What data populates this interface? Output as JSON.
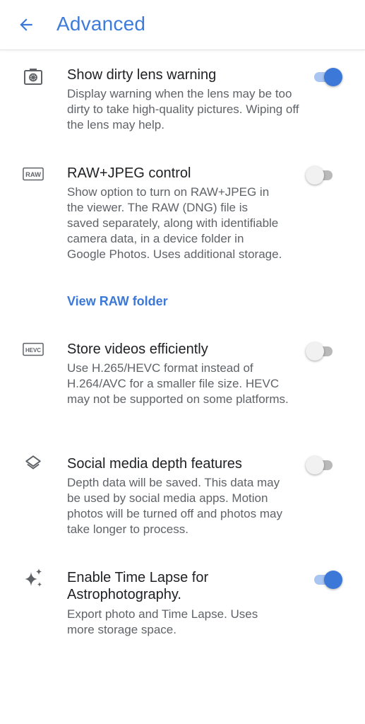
{
  "header": {
    "title": "Advanced"
  },
  "colors": {
    "accent": "#3b78d8",
    "title_text": "#202124",
    "secondary_text": "#5f6368",
    "toggle_off_track": "#b9b9b9"
  },
  "settings": [
    {
      "icon": "dirty-lens-icon",
      "title": "Show dirty lens warning",
      "description": "Display warning when the lens may be too dirty to take high-quality pictures. Wiping off the lens may help.",
      "enabled": true
    },
    {
      "icon": "raw-icon",
      "icon_text": "RAW",
      "title": "RAW+JPEG control",
      "description": "Show option to turn on RAW+JPEG in the viewer. The RAW (DNG) file is saved separately, along with identifiable camera data, in a device folder in Google Photos. Uses additional storage.",
      "link": "View RAW folder",
      "enabled": false
    },
    {
      "icon": "hevc-icon",
      "icon_text": "HEVC",
      "title": "Store videos efficiently",
      "description": "Use H.265/HEVC format instead of H.264/AVC for a smaller file size. HEVC may not be supported on some platforms.",
      "enabled": false
    },
    {
      "icon": "layers-icon",
      "title": "Social media depth features",
      "description": "Depth data will be saved. This data may be used by social media apps. Motion photos will be turned off and photos may take longer to process.",
      "enabled": false
    },
    {
      "icon": "sparkle-icon",
      "title": "Enable Time Lapse for Astrophotography.",
      "description": "Export photo and Time Lapse. Uses more storage space.",
      "enabled": true
    }
  ]
}
